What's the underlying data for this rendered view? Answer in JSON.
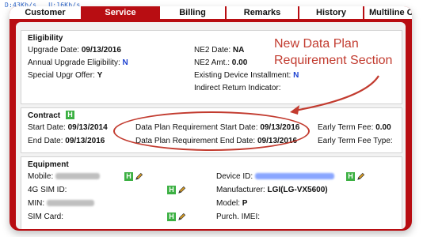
{
  "status_bar": {
    "download": "D:43Kb/s",
    "upload": "U:16Kb/s"
  },
  "tabs": [
    {
      "label": "Customer",
      "active": false
    },
    {
      "label": "Service",
      "active": true
    },
    {
      "label": "Billing",
      "active": false
    },
    {
      "label": "Remarks",
      "active": false
    },
    {
      "label": "History",
      "active": false
    },
    {
      "label": "Multiline Order /",
      "active": false
    }
  ],
  "eligibility": {
    "title": "Eligibility",
    "upgrade_date_label": "Upgrade Date:",
    "upgrade_date_value": "09/13/2016",
    "annual_label": "Annual Upgrade Eligibility:",
    "annual_value": "N",
    "special_label": "Special Upgr Offer:",
    "special_value": "Y",
    "ne2_date_label": "NE2 Date:",
    "ne2_date_value": "NA",
    "ne2_amt_label": "NE2 Amt.:",
    "ne2_amt_value": "0.00",
    "existing_label": "Existing Device Installment:",
    "existing_value": "N",
    "indirect_label": "Indirect Return Indicator:"
  },
  "contract": {
    "title": "Contract",
    "badge": "H",
    "start_label": "Start Date:",
    "start_value": "09/13/2014",
    "end_label": "End Date:",
    "end_value": "09/13/2016",
    "dp_start_label": "Data Plan Requirement Start Date:",
    "dp_start_value": "09/13/2016",
    "dp_end_label": "Data Plan Requirement End Date:",
    "dp_end_value": "09/13/2016",
    "early_fee_label": "Early Term Fee:",
    "early_fee_value": "0.00",
    "early_fee_type_label": "Early Term Fee Type:"
  },
  "equipment": {
    "title": "Equipment",
    "badge": "H",
    "mobile_label": "Mobile:",
    "sim_label": "4G SIM ID:",
    "min_label": "MIN:",
    "simcard_label": "SIM Card:",
    "device_label": "Device ID:",
    "manufacturer_label": "Manufacturer:",
    "manufacturer_value": "LGI(LG-VX5600)",
    "model_label": "Model:",
    "model_value": "P",
    "imei_label": "Purch. IMEI:"
  },
  "annotation": {
    "line1": "New Data Plan",
    "line2": "Requirement Section"
  },
  "colors": {
    "frame_red": "#b80d12",
    "annotation_red": "#c23b2f",
    "badge_green": "#3cb043",
    "value_blue": "#1a3fd0"
  }
}
